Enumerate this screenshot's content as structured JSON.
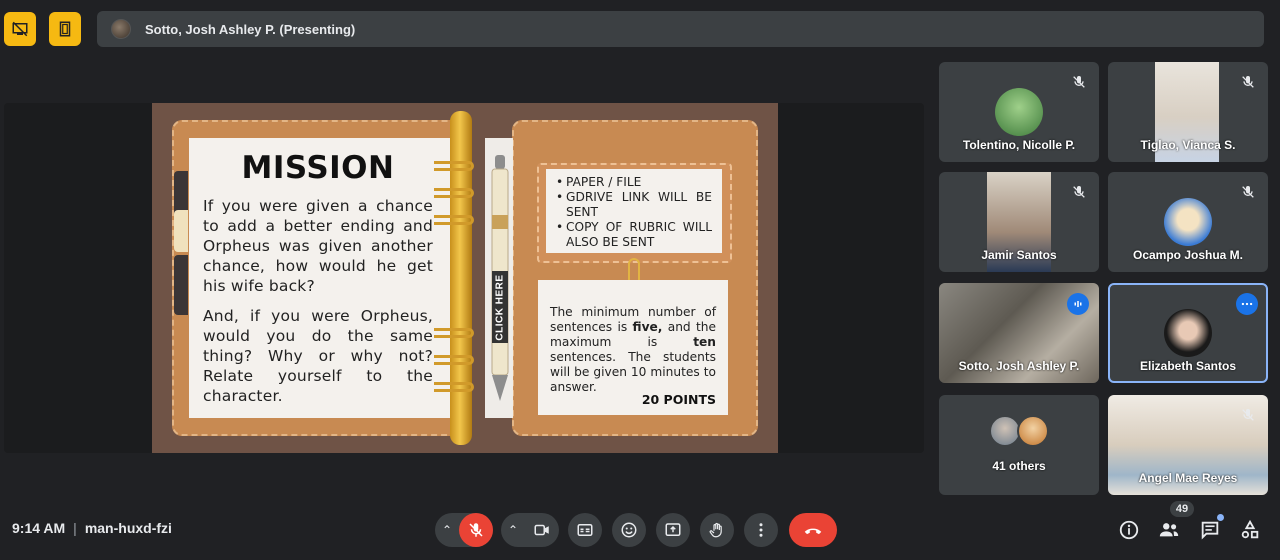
{
  "presenting": {
    "label": "Sotto, Josh Ashley P. (Presenting)"
  },
  "slide": {
    "title": "MISSION",
    "paragraph1": "If you were given a chance to add a better ending and Orpheus was given another chance, how would he get his wife back?",
    "paragraph2": "And, if you were Orpheus, would you do the same thing? Why or why not? Relate yourself to the character.",
    "pen_label": "CLICK HERE",
    "requirements": [
      "PAPER / FILE",
      "GDRIVE LINK WILL BE SENT",
      "COPY OF RUBRIC WILL ALSO BE SENT"
    ],
    "instructions": {
      "part1": "The minimum number of sentences is ",
      "min": "five,",
      "part2": " and the maximum is ",
      "max": "ten",
      "part3": " sentences. The students will be given 10 minutes to answer."
    },
    "points": "20 POINTS"
  },
  "tiles": [
    {
      "name": "Tolentino, Nicolle P."
    },
    {
      "name": "Tiglao, Vianca S."
    },
    {
      "name": "Jamir Santos"
    },
    {
      "name": "Ocampo Joshua M."
    },
    {
      "name": "Sotto, Josh Ashley P."
    },
    {
      "name": "Elizabeth Santos"
    },
    {
      "name": "41 others"
    },
    {
      "name": "Angel Mae Reyes"
    }
  ],
  "bottom": {
    "time": "9:14 AM",
    "separator": "|",
    "meeting_code": "man-huxd-fzi",
    "people_count": "49"
  },
  "colors": {
    "accent_yellow": "#f6b912",
    "end_call": "#ea4335",
    "mic_off": "#ea4335",
    "active_border": "#8ab4f8"
  }
}
